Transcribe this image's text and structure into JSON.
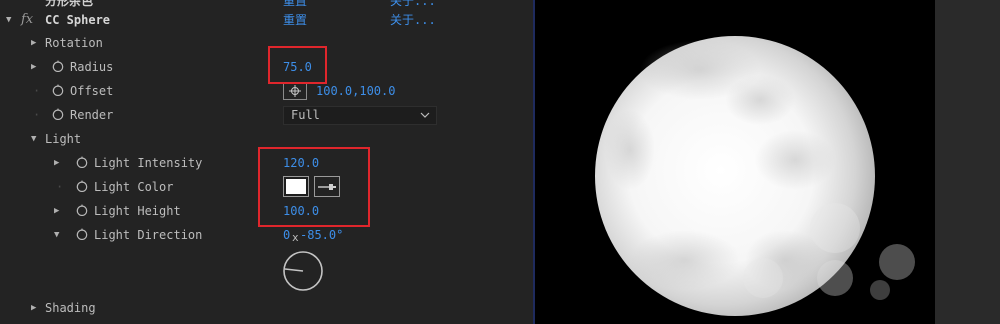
{
  "effect_header": {
    "prev_effect_label": "分形杂色",
    "prev_reset": "重置",
    "prev_about": "关于...",
    "fx_symbol": "fx",
    "name": "CC Sphere",
    "reset": "重置",
    "about": "关于..."
  },
  "properties": {
    "rotation": {
      "label": "Rotation"
    },
    "radius": {
      "label": "Radius",
      "value": "75.0"
    },
    "offset": {
      "label": "Offset",
      "value": "100.0,100.0"
    },
    "render": {
      "label": "Render",
      "value": "Full"
    },
    "light": {
      "label": "Light"
    },
    "light_intensity": {
      "label": "Light Intensity",
      "value": "120.0"
    },
    "light_color": {
      "label": "Light Color",
      "swatch_color": "#ffffff"
    },
    "light_height": {
      "label": "Light Height",
      "value": "100.0"
    },
    "light_direction": {
      "label": "Light Direction",
      "revolutions": "0",
      "x_symbol": "x",
      "degrees": "-85.0°"
    },
    "shading": {
      "label": "Shading"
    }
  },
  "icons": {
    "twirl_open": "▼",
    "twirl_closed": "▶",
    "stopwatch": "stopwatch-icon",
    "target": "crosshair-icon",
    "eyedropper": "eyedropper-icon",
    "chevron": "chevron-down-icon"
  },
  "colors": {
    "value_blue": "#3d8ee8",
    "highlight_red": "#e0262c",
    "panel_bg": "#232323",
    "viewer_bg": "#000000"
  }
}
